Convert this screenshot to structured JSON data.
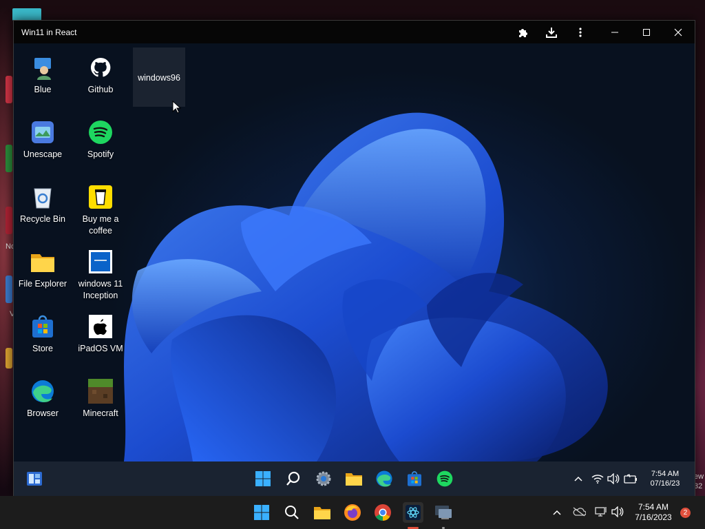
{
  "app": {
    "window_title": "Win11 in React"
  },
  "host_desktop": {
    "edge_labels": [
      "No",
      "V",
      "ew",
      "32"
    ]
  },
  "desktop": {
    "icons": [
      {
        "name": "Blue",
        "icon": "blue-person-icon"
      },
      {
        "name": "Github",
        "icon": "github-icon"
      },
      {
        "name": "windows96",
        "icon": "windows96-icon"
      },
      {
        "name": "Unescape",
        "icon": "unescape-icon"
      },
      {
        "name": "Spotify",
        "icon": "spotify-icon"
      },
      {
        "name": "Recycle Bin",
        "icon": "recycle-bin-icon"
      },
      {
        "name": "Buy me a coffee",
        "icon": "coffee-cup-icon"
      },
      {
        "name": "File Explorer",
        "icon": "folder-icon"
      },
      {
        "name": "windows 11 Inception",
        "icon": "windows-logo-icon"
      },
      {
        "name": "Store",
        "icon": "store-icon"
      },
      {
        "name": "iPadOS VM",
        "icon": "apple-icon"
      },
      {
        "name": "Browser",
        "icon": "edge-icon"
      },
      {
        "name": "Minecraft",
        "icon": "minecraft-icon"
      }
    ]
  },
  "inner_taskbar": {
    "apps": [
      "widgets-icon",
      "start-icon",
      "search-icon",
      "settings-icon",
      "file-explorer-icon",
      "edge-icon",
      "store-icon",
      "spotify-icon"
    ],
    "tray": [
      "chevron-up-icon",
      "wifi-icon",
      "speaker-icon",
      "battery-icon"
    ],
    "time": "7:54 AM",
    "date": "07/16/23"
  },
  "host_taskbar": {
    "apps": [
      "start-icon",
      "search-icon",
      "file-explorer-icon",
      "firefox-icon",
      "chrome-icon",
      "win11-react-app-icon",
      "remote-desktop-icon"
    ],
    "tray": [
      "chevron-up-icon",
      "onedrive-icon",
      "network-icon",
      "speaker-icon"
    ],
    "time": "7:54 AM",
    "date": "7/16/2023",
    "notification_count": "2"
  },
  "colors": {
    "inner_taskbar": "#1a2331",
    "host_taskbar": "#1c1c1c",
    "wallpaper_blue": "#1d4fd8",
    "spotify_green": "#1ed760",
    "notification_badge": "#e04f3c"
  }
}
